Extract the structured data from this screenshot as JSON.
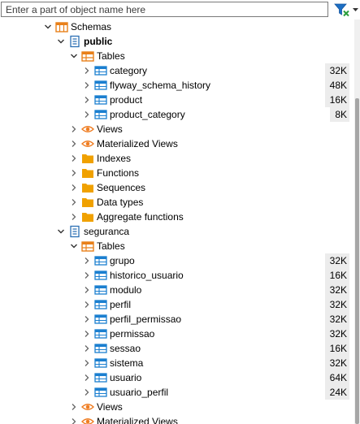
{
  "filter": {
    "placeholder": "Enter a part of object name here",
    "value": "",
    "filter_icon": "funnel-icon",
    "dropdown_icon": "triangle-down-icon"
  },
  "colors": {
    "table_icon": "#1b7fd0",
    "folder_icon": "#f0a100",
    "tables_folder_icon": "#e8801a",
    "view_icon": "#ef7d22",
    "schema_icon": "#2b6fb4",
    "size_bg": "#ececec"
  },
  "tree": [
    {
      "id": "schemas",
      "depth": 0,
      "expand": "open",
      "icon": "schemas-folder-icon",
      "label": "Schemas",
      "bold": false,
      "size": ""
    },
    {
      "id": "public",
      "depth": 1,
      "expand": "open",
      "icon": "schema-icon",
      "label": "public",
      "bold": true,
      "size": ""
    },
    {
      "id": "public-tables",
      "depth": 2,
      "expand": "open",
      "icon": "tables-folder-icon",
      "label": "Tables",
      "bold": false,
      "size": ""
    },
    {
      "id": "category",
      "depth": 3,
      "expand": "closed",
      "icon": "table-icon",
      "label": "category",
      "bold": false,
      "size": "32K"
    },
    {
      "id": "flyway_schema_history",
      "depth": 3,
      "expand": "closed",
      "icon": "table-icon",
      "label": "flyway_schema_history",
      "bold": false,
      "size": "48K"
    },
    {
      "id": "product",
      "depth": 3,
      "expand": "closed",
      "icon": "table-icon",
      "label": "product",
      "bold": false,
      "size": "16K"
    },
    {
      "id": "product_category",
      "depth": 3,
      "expand": "closed",
      "icon": "table-icon",
      "label": "product_category",
      "bold": false,
      "size": "8K"
    },
    {
      "id": "public-views",
      "depth": 2,
      "expand": "closed",
      "icon": "view-icon",
      "label": "Views",
      "bold": false,
      "size": ""
    },
    {
      "id": "public-mviews",
      "depth": 2,
      "expand": "closed",
      "icon": "view-icon",
      "label": "Materialized Views",
      "bold": false,
      "size": ""
    },
    {
      "id": "public-indexes",
      "depth": 2,
      "expand": "closed",
      "icon": "folder-icon",
      "label": "Indexes",
      "bold": false,
      "size": ""
    },
    {
      "id": "public-functions",
      "depth": 2,
      "expand": "closed",
      "icon": "folder-icon",
      "label": "Functions",
      "bold": false,
      "size": ""
    },
    {
      "id": "public-sequences",
      "depth": 2,
      "expand": "closed",
      "icon": "folder-icon",
      "label": "Sequences",
      "bold": false,
      "size": ""
    },
    {
      "id": "public-datatypes",
      "depth": 2,
      "expand": "closed",
      "icon": "folder-icon",
      "label": "Data types",
      "bold": false,
      "size": ""
    },
    {
      "id": "public-aggregates",
      "depth": 2,
      "expand": "closed",
      "icon": "folder-icon",
      "label": "Aggregate functions",
      "bold": false,
      "size": ""
    },
    {
      "id": "seguranca",
      "depth": 1,
      "expand": "open",
      "icon": "schema-icon",
      "label": "seguranca",
      "bold": false,
      "size": ""
    },
    {
      "id": "seguranca-tables",
      "depth": 2,
      "expand": "open",
      "icon": "tables-folder-icon",
      "label": "Tables",
      "bold": false,
      "size": ""
    },
    {
      "id": "grupo",
      "depth": 3,
      "expand": "closed",
      "icon": "table-icon",
      "label": "grupo",
      "bold": false,
      "size": "32K"
    },
    {
      "id": "historico_usuario",
      "depth": 3,
      "expand": "closed",
      "icon": "table-icon",
      "label": "historico_usuario",
      "bold": false,
      "size": "16K"
    },
    {
      "id": "modulo",
      "depth": 3,
      "expand": "closed",
      "icon": "table-icon",
      "label": "modulo",
      "bold": false,
      "size": "32K"
    },
    {
      "id": "perfil",
      "depth": 3,
      "expand": "closed",
      "icon": "table-icon",
      "label": "perfil",
      "bold": false,
      "size": "32K"
    },
    {
      "id": "perfil_permissao",
      "depth": 3,
      "expand": "closed",
      "icon": "table-icon",
      "label": "perfil_permissao",
      "bold": false,
      "size": "32K"
    },
    {
      "id": "permissao",
      "depth": 3,
      "expand": "closed",
      "icon": "table-icon",
      "label": "permissao",
      "bold": false,
      "size": "32K"
    },
    {
      "id": "sessao",
      "depth": 3,
      "expand": "closed",
      "icon": "table-icon",
      "label": "sessao",
      "bold": false,
      "size": "16K"
    },
    {
      "id": "sistema",
      "depth": 3,
      "expand": "closed",
      "icon": "table-icon",
      "label": "sistema",
      "bold": false,
      "size": "32K"
    },
    {
      "id": "usuario",
      "depth": 3,
      "expand": "closed",
      "icon": "table-icon",
      "label": "usuario",
      "bold": false,
      "size": "64K"
    },
    {
      "id": "usuario_perfil",
      "depth": 3,
      "expand": "closed",
      "icon": "table-icon",
      "label": "usuario_perfil",
      "bold": false,
      "size": "24K"
    },
    {
      "id": "seguranca-views",
      "depth": 2,
      "expand": "closed",
      "icon": "view-icon",
      "label": "Views",
      "bold": false,
      "size": ""
    },
    {
      "id": "seguranca-mviews",
      "depth": 2,
      "expand": "closed",
      "icon": "view-icon",
      "label": "Materialized Views",
      "bold": false,
      "size": ""
    }
  ]
}
